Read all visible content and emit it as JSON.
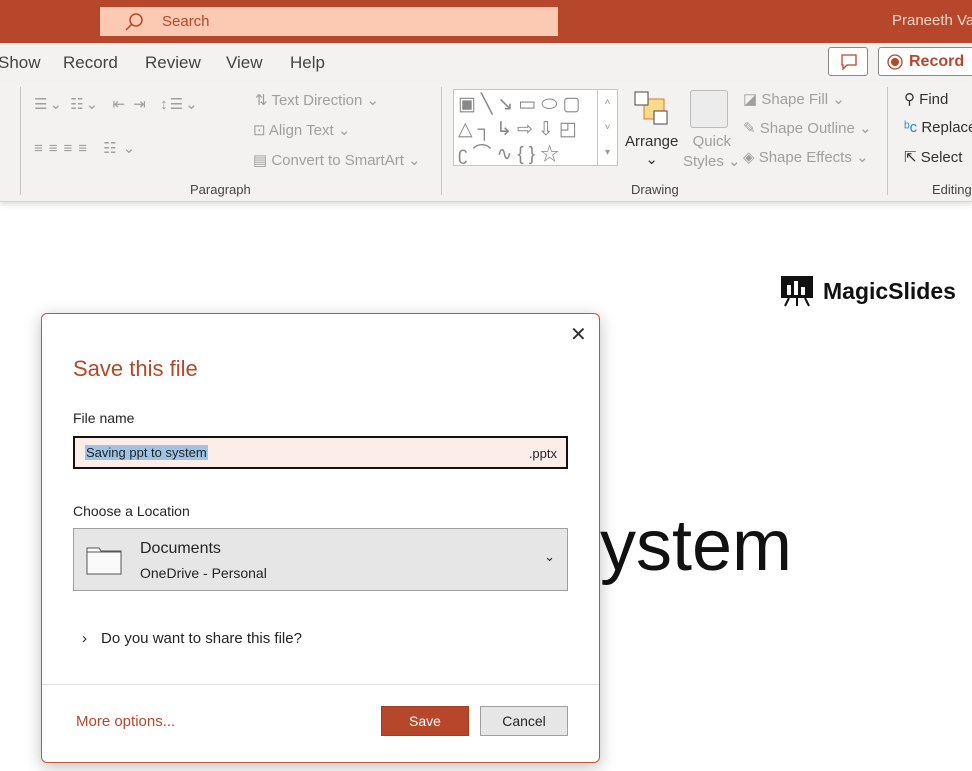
{
  "titlebar": {
    "search_placeholder": "Search",
    "user": "Praneeth Varma"
  },
  "menu": {
    "items": [
      "Show",
      "Record",
      "Review",
      "View",
      "Help"
    ],
    "record_button": "Record"
  },
  "ribbon": {
    "paragraph": {
      "text_direction": "Text Direction",
      "align_text": "Align Text",
      "convert_smartart": "Convert to SmartArt",
      "label": "Paragraph"
    },
    "drawing": {
      "arrange": "Arrange",
      "quick_styles_1": "Quick",
      "quick_styles_2": "Styles",
      "shape_fill": "Shape Fill",
      "shape_outline": "Shape Outline",
      "shape_effects": "Shape Effects",
      "label": "Drawing"
    },
    "editing": {
      "find": "Find",
      "replace": "Replace",
      "select": "Select",
      "label": "Editing"
    }
  },
  "slide": {
    "logo": "MagicSlides",
    "title_fragment": "ystem"
  },
  "dialog": {
    "title": "Save this file",
    "file_name_label": "File name",
    "file_name": "Saving ppt to system",
    "extension": ".pptx",
    "location_label": "Choose a Location",
    "location_name": "Documents",
    "location_sub": "OneDrive - Personal",
    "share_question": "Do you want to share this file?",
    "more_options": "More options...",
    "save": "Save",
    "cancel": "Cancel"
  },
  "colors": {
    "accent": "#b7472a",
    "search_bg": "#fcc9b3"
  }
}
